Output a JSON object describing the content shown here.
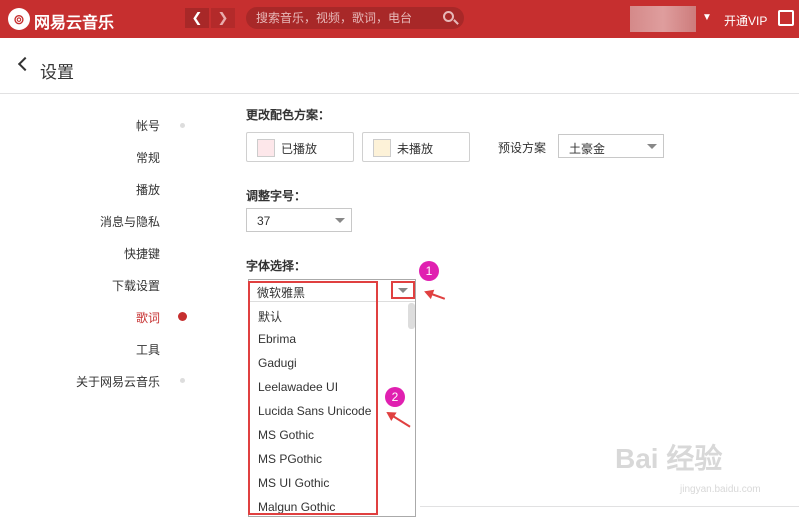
{
  "app": {
    "logo_glyph": "⊚",
    "title": "网易云音乐"
  },
  "topbar": {
    "back_glyph": "❮",
    "forward_glyph": "❯",
    "search_placeholder": "搜索音乐，视频，歌词，电台",
    "user_menu_glyph": "▼",
    "vip_label": "开通VIP",
    "accent_color": "#c62f2f"
  },
  "page": {
    "title": "设置"
  },
  "sidebar": {
    "items": [
      {
        "label": "帐号"
      },
      {
        "label": "常规"
      },
      {
        "label": "播放"
      },
      {
        "label": "消息与隐私"
      },
      {
        "label": "快捷键"
      },
      {
        "label": "下载设置"
      },
      {
        "label": "歌词",
        "active": true
      },
      {
        "label": "工具"
      },
      {
        "label": "关于网易云音乐"
      }
    ]
  },
  "lyrics": {
    "color_scheme_label": "更改配色方案：",
    "played_label": "已播放",
    "unplayed_label": "未播放",
    "preset_label": "预设方案",
    "preset_value": "土豪金",
    "font_size_label": "调整字号：",
    "font_size_value": "37",
    "font_label": "字体选择：",
    "font_value": "微软雅黑",
    "font_options": [
      "默认",
      "Ebrima",
      "Gadugi",
      "Leelawadee UI",
      "Lucida Sans Unicode",
      "MS Gothic",
      "MS PGothic",
      "MS UI Gothic",
      "Malgun Gothic"
    ]
  },
  "annotations": {
    "badge_1": "1",
    "badge_2": "2"
  },
  "watermark": {
    "main": "Bai 经验",
    "sub": "jingyan.baidu.com"
  }
}
